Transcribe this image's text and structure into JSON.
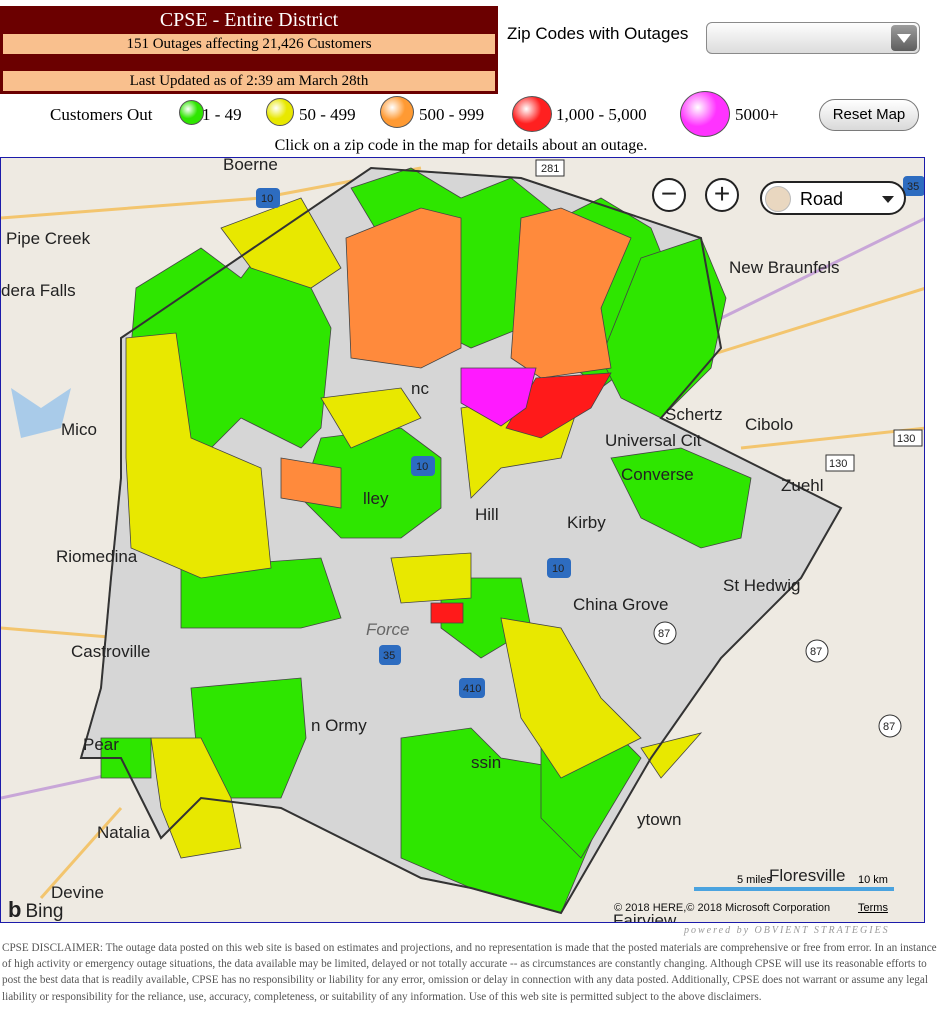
{
  "header": {
    "title": "CPSE - Entire District",
    "summary": "151 Outages affecting 21,426 Customers",
    "updated": "Last Updated as of 2:39 am March 28th"
  },
  "zip_select": {
    "label": "Zip Codes with Outages",
    "value": ""
  },
  "legend": {
    "label": "Customers Out",
    "items": [
      {
        "label": "1 - 49",
        "color": "#2ee600"
      },
      {
        "label": "50 - 499",
        "color": "#e8e800"
      },
      {
        "label": "500 - 999",
        "color": "#ff9a33"
      },
      {
        "label": "1,000 - 5,000",
        "color": "#ff2020"
      },
      {
        "label": "5000+",
        "color": "#ff33ff"
      }
    ]
  },
  "reset_button": "Reset Map",
  "instruction": "Click on a zip code in the map for details about an outage.",
  "map": {
    "style": "Road",
    "zoom_out": "−",
    "zoom_in": "+",
    "places": [
      "Boerne",
      "Pipe Creek",
      "dera Falls",
      "Mico",
      "Riomedina",
      "Castroville",
      "Natalia",
      "Devine",
      "New Braunfels",
      "Schertz",
      "Cibolo",
      "Universal Cit",
      "Converse",
      "Zuehl",
      "Kirby",
      "St Hedwig",
      "China Grove",
      "Pear",
      "n Ormy",
      "ssin",
      "ytown",
      "Floresville",
      "Fairview",
      "Hill",
      "lley",
      "Force",
      "nc"
    ],
    "shields": [
      "10",
      "281",
      "35",
      "130",
      "130",
      "87",
      "87",
      "87",
      "35",
      "410",
      "10",
      "10"
    ],
    "attribution_bing": "Bing",
    "scale_miles": "5 miles",
    "scale_km": "10 km",
    "copyright": "© 2018 HERE,© 2018 Microsoft Corporation",
    "terms": "Terms"
  },
  "powered_by": "powered by OBVIENT STRATEGIES",
  "disclaimer": "CPSE DISCLAIMER:  The outage data posted on this web site is based on estimates and projections, and no representation is made that the posted materials are comprehensive or free from error.  In an instance of high activity or emergency outage situations, the data available may be limited, delayed or not totally accurate -- as circumstances are constantly changing.  Although CPSE will use its reasonable efforts to post the best data that is readily available, CPSE has no responsibility or liability for any error, omission or delay in connection with any data posted.  Additionally, CPSE does not warrant or assume any legal liability or responsibility for the reliance, use, accuracy, completeness, or suitability of any information.  Use of this web site is permitted subject to the above disclaimers."
}
